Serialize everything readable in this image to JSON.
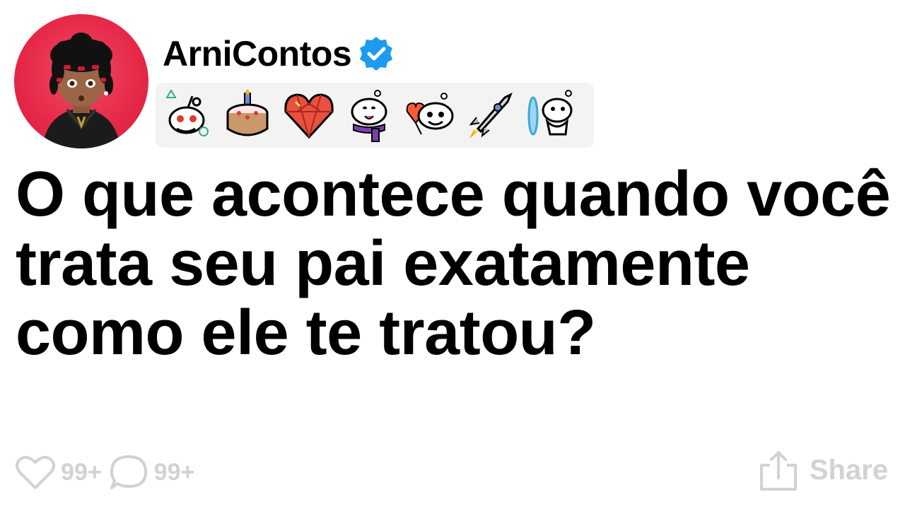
{
  "post": {
    "author": "ArniContos",
    "title": "O que acontece quando você trata seu pai exatamente como ele te tratou?"
  },
  "badges": [
    {
      "icon": "reddit-snoo-playstation-icon"
    },
    {
      "icon": "cake-day-icon"
    },
    {
      "icon": "gem-heart-icon"
    },
    {
      "icon": "snoo-scarf-icon"
    },
    {
      "icon": "snoo-heart-balloon-icon"
    },
    {
      "icon": "rocket-icon"
    },
    {
      "icon": "snoo-portal-icon"
    }
  ],
  "footer": {
    "likes": "99+",
    "comments": "99+",
    "share_label": "Share"
  },
  "colors": {
    "avatar_bg": "#e62848",
    "verified": "#1d9bf0",
    "muted": "#d2d2d2"
  }
}
